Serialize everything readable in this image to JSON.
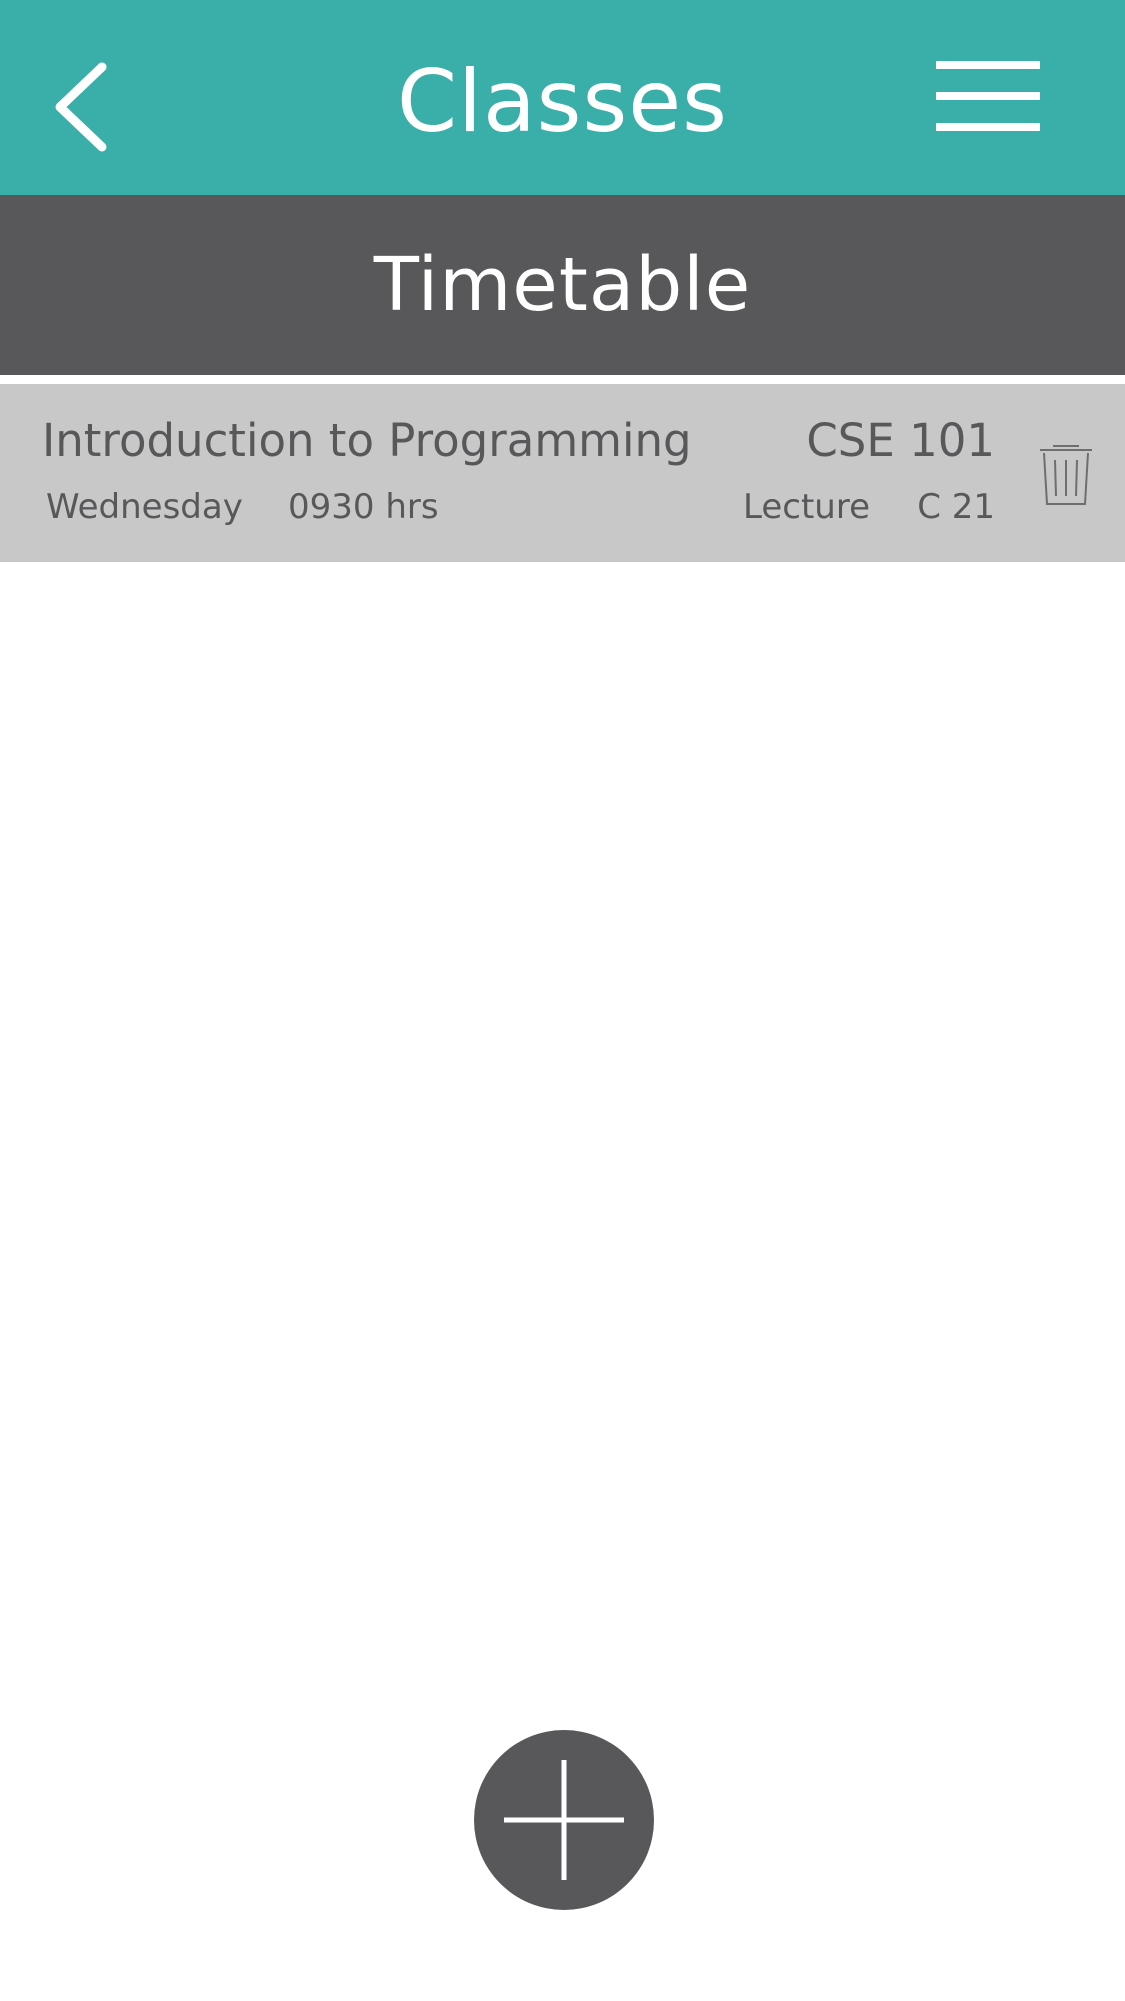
{
  "header": {
    "title": "Classes",
    "back_icon": "chevron-left-icon",
    "menu_icon": "hamburger-menu-icon"
  },
  "subheader": {
    "title": "Timetable"
  },
  "classes": [
    {
      "name": "Introduction to Programming",
      "code": "CSE 101",
      "day": "Wednesday",
      "time": "0930 hrs",
      "type": "Lecture",
      "room": "C 21",
      "delete_icon": "trash-icon"
    }
  ],
  "fab": {
    "icon": "plus-icon"
  },
  "colors": {
    "header": "#3aaea8",
    "subheader": "#58585a",
    "row": "#c8c8c8",
    "text": "#58585a",
    "fab": "#58585a"
  }
}
